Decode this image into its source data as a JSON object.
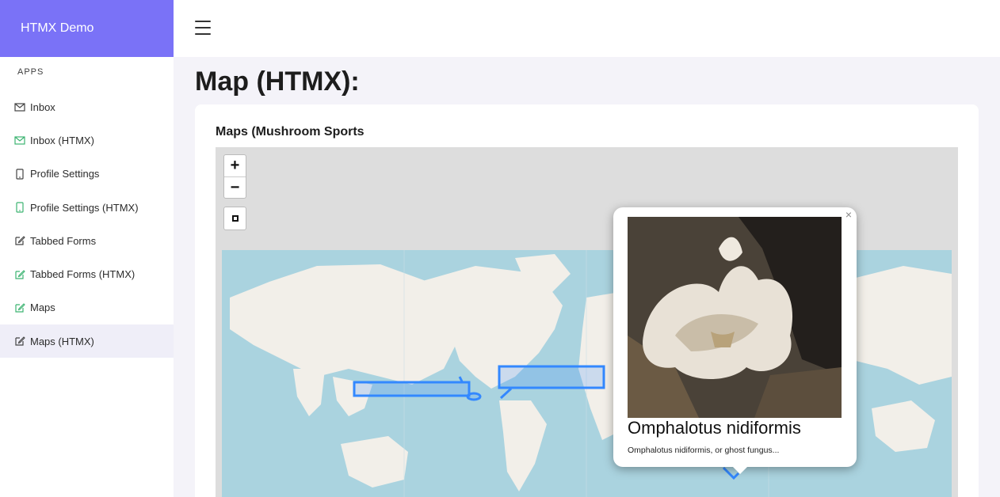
{
  "app": {
    "brand": "HTMX Demo"
  },
  "sidebar": {
    "section_label": "APPS",
    "items": [
      {
        "label": "Inbox",
        "icon": "mail-icon",
        "icon_color": "#444444"
      },
      {
        "label": "Inbox (HTMX)",
        "icon": "mail-icon",
        "icon_color": "#3cb371"
      },
      {
        "label": "Profile Settings",
        "icon": "phone-icon",
        "icon_color": "#444444"
      },
      {
        "label": "Profile Settings (HTMX)",
        "icon": "phone-icon",
        "icon_color": "#3cb371"
      },
      {
        "label": "Tabbed Forms",
        "icon": "edit-icon",
        "icon_color": "#444444"
      },
      {
        "label": "Tabbed Forms (HTMX)",
        "icon": "edit-icon",
        "icon_color": "#3cb371"
      },
      {
        "label": "Maps",
        "icon": "edit-icon",
        "icon_color": "#3cb371"
      },
      {
        "label": "Maps (HTMX)",
        "icon": "edit-icon",
        "icon_color": "#444444",
        "active": true
      }
    ]
  },
  "page": {
    "title": "Map (HTMX):"
  },
  "card": {
    "title": "Maps (Mushroom Sports"
  },
  "map": {
    "zoom_in": "+",
    "zoom_out": "−",
    "popup": {
      "close": "×",
      "title": "Omphalotus nidiformis",
      "description": "Omphalotus nidiformis, or ghost fungus..."
    }
  },
  "colors": {
    "brand": "#7a72f7",
    "accent_green": "#3cb371",
    "shape_blue": "#3388ff",
    "water": "#aad3df",
    "land": "#f2efe9"
  }
}
